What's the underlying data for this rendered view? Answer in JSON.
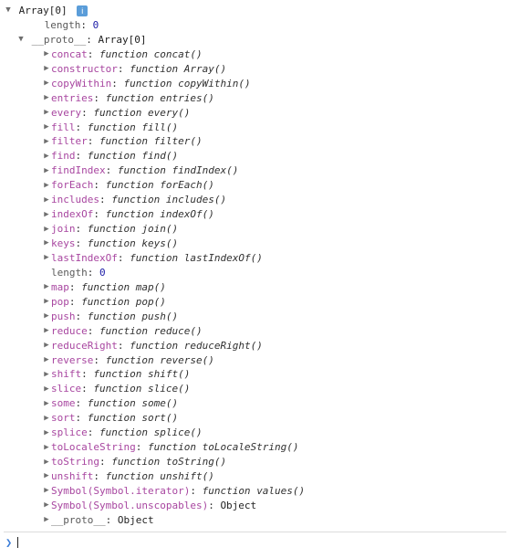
{
  "root": {
    "label": "Array[0]",
    "disclosure": "expanded",
    "info_badge": "i"
  },
  "length_prop": {
    "key": "length",
    "value": "0"
  },
  "proto_row": {
    "key": "__proto__",
    "desc": "Array[0]",
    "disclosure": "expanded"
  },
  "methods": [
    {
      "key": "concat",
      "type": "function",
      "fname": "concat",
      "disclosure": "collapsed"
    },
    {
      "key": "constructor",
      "type": "function",
      "fname": "Array",
      "disclosure": "collapsed"
    },
    {
      "key": "copyWithin",
      "type": "function",
      "fname": "copyWithin",
      "disclosure": "collapsed"
    },
    {
      "key": "entries",
      "type": "function",
      "fname": "entries",
      "disclosure": "collapsed"
    },
    {
      "key": "every",
      "type": "function",
      "fname": "every",
      "disclosure": "collapsed"
    },
    {
      "key": "fill",
      "type": "function",
      "fname": "fill",
      "disclosure": "collapsed"
    },
    {
      "key": "filter",
      "type": "function",
      "fname": "filter",
      "disclosure": "collapsed"
    },
    {
      "key": "find",
      "type": "function",
      "fname": "find",
      "disclosure": "collapsed"
    },
    {
      "key": "findIndex",
      "type": "function",
      "fname": "findIndex",
      "disclosure": "collapsed"
    },
    {
      "key": "forEach",
      "type": "function",
      "fname": "forEach",
      "disclosure": "collapsed"
    },
    {
      "key": "includes",
      "type": "function",
      "fname": "includes",
      "disclosure": "collapsed"
    },
    {
      "key": "indexOf",
      "type": "function",
      "fname": "indexOf",
      "disclosure": "collapsed"
    },
    {
      "key": "join",
      "type": "function",
      "fname": "join",
      "disclosure": "collapsed"
    },
    {
      "key": "keys",
      "type": "function",
      "fname": "keys",
      "disclosure": "collapsed"
    },
    {
      "key": "lastIndexOf",
      "type": "function",
      "fname": "lastIndexOf",
      "disclosure": "collapsed"
    },
    {
      "key": "length",
      "type": "plain",
      "value": "0",
      "disclosure": "none"
    },
    {
      "key": "map",
      "type": "function",
      "fname": "map",
      "disclosure": "collapsed"
    },
    {
      "key": "pop",
      "type": "function",
      "fname": "pop",
      "disclosure": "collapsed"
    },
    {
      "key": "push",
      "type": "function",
      "fname": "push",
      "disclosure": "collapsed"
    },
    {
      "key": "reduce",
      "type": "function",
      "fname": "reduce",
      "disclosure": "collapsed"
    },
    {
      "key": "reduceRight",
      "type": "function",
      "fname": "reduceRight",
      "disclosure": "collapsed"
    },
    {
      "key": "reverse",
      "type": "function",
      "fname": "reverse",
      "disclosure": "collapsed"
    },
    {
      "key": "shift",
      "type": "function",
      "fname": "shift",
      "disclosure": "collapsed"
    },
    {
      "key": "slice",
      "type": "function",
      "fname": "slice",
      "disclosure": "collapsed"
    },
    {
      "key": "some",
      "type": "function",
      "fname": "some",
      "disclosure": "collapsed"
    },
    {
      "key": "sort",
      "type": "function",
      "fname": "sort",
      "disclosure": "collapsed"
    },
    {
      "key": "splice",
      "type": "function",
      "fname": "splice",
      "disclosure": "collapsed"
    },
    {
      "key": "toLocaleString",
      "type": "function",
      "fname": "toLocaleString",
      "disclosure": "collapsed"
    },
    {
      "key": "toString",
      "type": "function",
      "fname": "toString",
      "disclosure": "collapsed"
    },
    {
      "key": "unshift",
      "type": "function",
      "fname": "unshift",
      "disclosure": "collapsed"
    },
    {
      "key": "Symbol(Symbol.iterator)",
      "type": "function",
      "fname": "values",
      "disclosure": "collapsed"
    },
    {
      "key": "Symbol(Symbol.unscopables)",
      "type": "object",
      "value": "Object",
      "disclosure": "collapsed"
    },
    {
      "key": "__proto__",
      "type": "object",
      "value": "Object",
      "disclosure": "collapsed"
    }
  ],
  "keyword_function": "function",
  "prompt_symbol": "❯"
}
